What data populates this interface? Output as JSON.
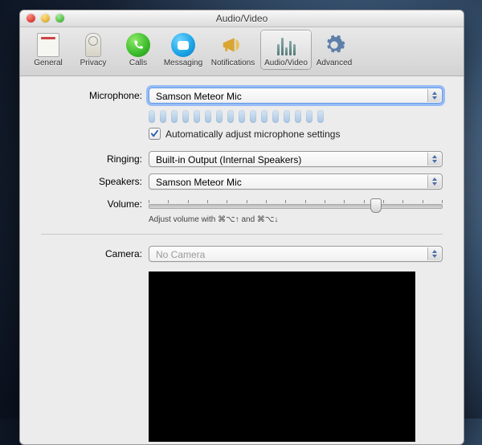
{
  "window": {
    "title": "Audio/Video"
  },
  "toolbar": {
    "items": [
      {
        "label": "General"
      },
      {
        "label": "Privacy"
      },
      {
        "label": "Calls"
      },
      {
        "label": "Messaging"
      },
      {
        "label": "Notifications"
      },
      {
        "label": "Audio/Video"
      },
      {
        "label": "Advanced"
      }
    ],
    "selected_index": 5
  },
  "form": {
    "microphone": {
      "label": "Microphone:",
      "value": "Samson Meteor Mic",
      "level_bars": 16
    },
    "auto_adjust": {
      "checked": true,
      "label": "Automatically adjust microphone settings"
    },
    "ringing": {
      "label": "Ringing:",
      "value": "Built-in Output (Internal Speakers)"
    },
    "speakers": {
      "label": "Speakers:",
      "value": "Samson Meteor Mic"
    },
    "volume": {
      "label": "Volume:",
      "position_pct": 77,
      "ticks": 16,
      "hint": "Adjust volume with ⌘⌥↑ and ⌘⌥↓"
    },
    "camera": {
      "label": "Camera:",
      "value": "No Camera",
      "enabled": false
    }
  }
}
